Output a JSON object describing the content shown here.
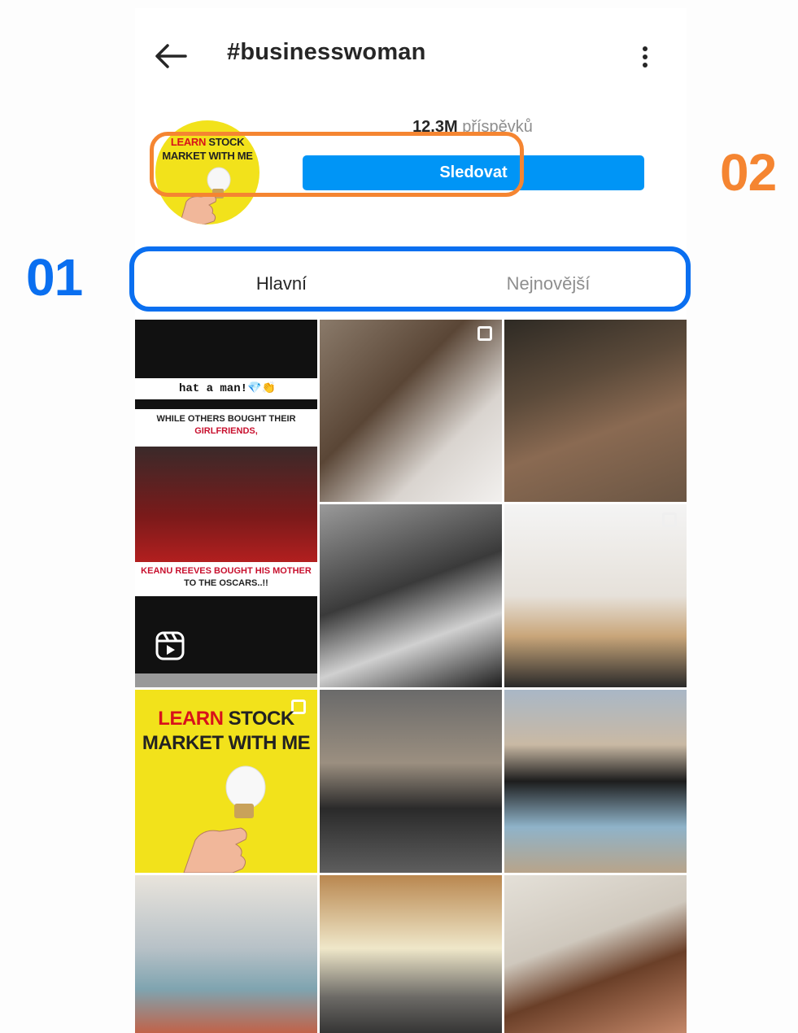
{
  "header": {
    "title": "#businesswoman"
  },
  "hashtag": {
    "avatar_line1_red": "LEARN",
    "avatar_line1_dark": " STOCK",
    "avatar_line2": "MARKET WITH ME",
    "post_count": "12.3M",
    "post_count_suffix": " příspěvků",
    "follow_label": "Sledovat"
  },
  "tabs": [
    {
      "label": "Hlavní",
      "selected": true
    },
    {
      "label": "Nejnovější",
      "selected": false
    }
  ],
  "annotations": {
    "label_tabs": "01",
    "label_follow": "02",
    "color_tabs": "#0a6ff0",
    "color_follow": "#f58531"
  },
  "grid": {
    "reel_post": {
      "caption": "hat a man!💎👏",
      "line1": "WHILE OTHERS BOUGHT THEIR",
      "line2": "GIRLFRIENDS,",
      "line3": "KEANU REEVES BOUGHT HIS MOTHER",
      "line4": "TO THE OSCARS..!!"
    },
    "learn_post": {
      "line1_red": "LEARN",
      "line1_dark": " STOCK",
      "line2": "MARKET WITH ME"
    }
  },
  "colors": {
    "accent": "#0095f6",
    "text": "#262626",
    "muted": "#8e8e8e"
  }
}
